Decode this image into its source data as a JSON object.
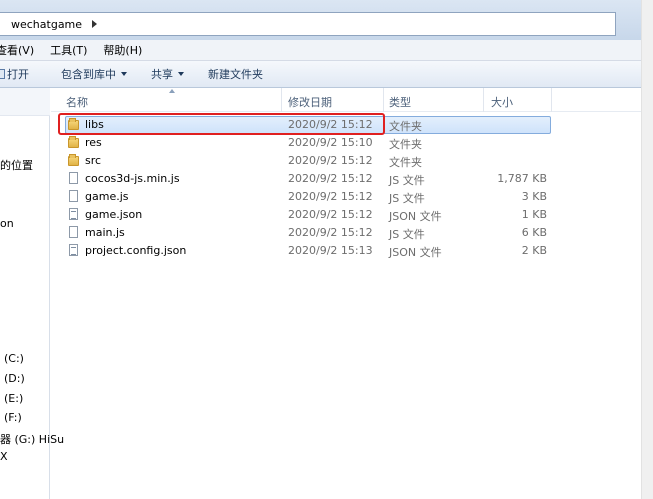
{
  "address": {
    "crumb": "wechatgame"
  },
  "menu": [
    {
      "label": "查看(V)"
    },
    {
      "label": "工具(T)"
    },
    {
      "label": "帮助(H)"
    }
  ],
  "toolbar": {
    "open": "打开",
    "include": "包含到库中",
    "share": "共享",
    "new_folder": "新建文件夹"
  },
  "nav": [
    {
      "label": "的位置"
    },
    {
      "label": "on"
    },
    {
      "label": "(C:)"
    },
    {
      "label": "(D:)"
    },
    {
      "label": "(E:)"
    },
    {
      "label": "(F:)"
    },
    {
      "label": "器 (G:) HiSu"
    },
    {
      "label": "X"
    }
  ],
  "columns": {
    "name": "名称",
    "date": "修改日期",
    "type": "类型",
    "size": "大小"
  },
  "files": [
    {
      "name": "libs",
      "date": "2020/9/2 15:12",
      "type": "文件夹",
      "size": "",
      "icon": "folder-icon"
    },
    {
      "name": "res",
      "date": "2020/9/2 15:10",
      "type": "文件夹",
      "size": "",
      "icon": "folder-icon"
    },
    {
      "name": "src",
      "date": "2020/9/2 15:12",
      "type": "文件夹",
      "size": "",
      "icon": "folder-icon"
    },
    {
      "name": "cocos3d-js.min.js",
      "date": "2020/9/2 15:12",
      "type": "JS 文件",
      "size": "1,787 KB",
      "icon": "file-icon"
    },
    {
      "name": "game.js",
      "date": "2020/9/2 15:12",
      "type": "JS 文件",
      "size": "3 KB",
      "icon": "file-icon"
    },
    {
      "name": "game.json",
      "date": "2020/9/2 15:12",
      "type": "JSON 文件",
      "size": "1 KB",
      "icon": "file-icon"
    },
    {
      "name": "main.js",
      "date": "2020/9/2 15:12",
      "type": "JS 文件",
      "size": "6 KB",
      "icon": "file-icon"
    },
    {
      "name": "project.config.json",
      "date": "2020/9/2 15:13",
      "type": "JSON 文件",
      "size": "2 KB",
      "icon": "file-icon"
    }
  ],
  "colors": {
    "highlight": "#e02020",
    "selection": "#cfe3fb"
  }
}
